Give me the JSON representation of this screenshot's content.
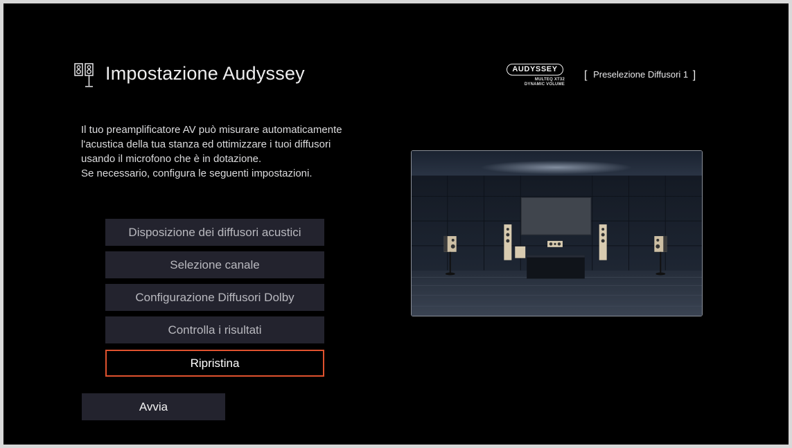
{
  "header": {
    "title": "Impostazione Audyssey",
    "icon": "speakers-icon",
    "logo": {
      "brand": "AUDYSSEY",
      "line1": "MULTEQ XT32",
      "line2": "DYNAMIC VOLUME"
    },
    "preset": {
      "open_bracket": "[",
      "label": "Preselezione Diffusori 1",
      "close_bracket": "]"
    }
  },
  "description": {
    "lines": [
      "Il tuo preamplificatore AV può misurare automaticamente",
      "l'acustica della tua stanza ed ottimizzare i tuoi diffusori",
      "usando il microfono che è in dotazione.",
      "Se necessario, configura le seguenti impostazioni."
    ]
  },
  "menu": {
    "items": [
      {
        "label": "Disposizione dei diffusori acustici",
        "selected": false
      },
      {
        "label": "Selezione canale",
        "selected": false
      },
      {
        "label": "Configurazione Diffusori Dolby",
        "selected": false
      },
      {
        "label": "Controlla i risultati",
        "selected": false
      },
      {
        "label": "Ripristina",
        "selected": true
      }
    ],
    "start_label": "Avvia"
  },
  "colors": {
    "background": "#000000",
    "button": "#23232e",
    "selection_border": "#e0522e",
    "text": "#e8e8ea"
  }
}
